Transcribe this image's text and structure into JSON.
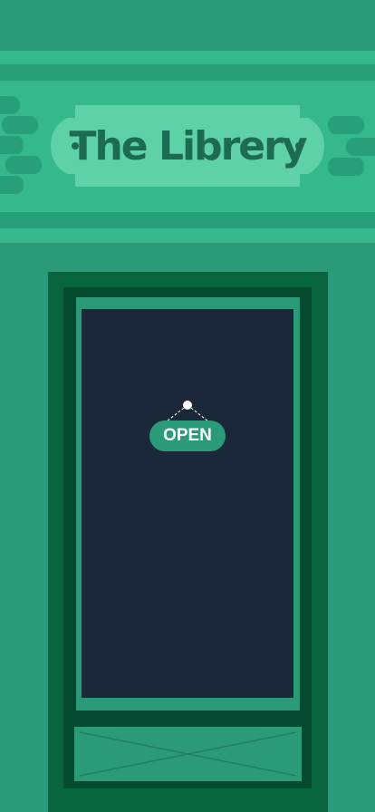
{
  "storefront": {
    "title": "The Librery"
  },
  "door": {
    "sign_label": "OPEN"
  },
  "colors": {
    "wall": "#2a9a78",
    "facade": "#34b88c",
    "plaque": "#5ed1a8",
    "title_text": "#1c6b52",
    "door_frame": "#08663f",
    "door_frame_dark": "#054a2e",
    "glass": "#1b2839",
    "sign": "#2a9a78"
  }
}
